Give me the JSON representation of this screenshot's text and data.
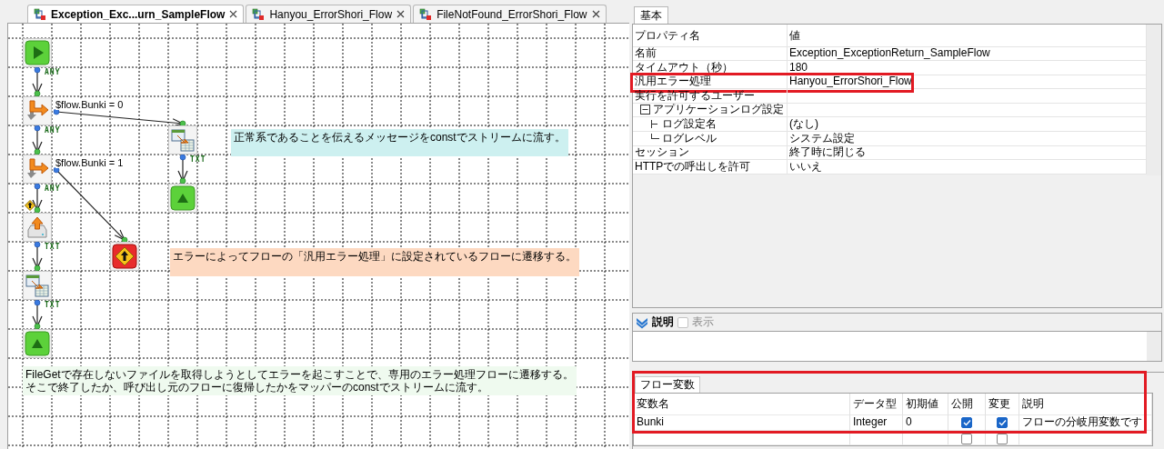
{
  "editor_tabs": [
    {
      "label": "Exception_Exc...urn_SampleFlow",
      "selected": true
    },
    {
      "label": "Hanyou_ErrorShori_Flow",
      "selected": false
    },
    {
      "label": "FileNotFound_ErrorShori_Flow",
      "selected": false
    }
  ],
  "canvas": {
    "nodes": [
      {
        "kind": "start"
      },
      {
        "kind": "branch",
        "condition": "$flow.Bunki = 0"
      },
      {
        "kind": "mapper"
      },
      {
        "kind": "branch",
        "condition": "$flow.Bunki = 1"
      },
      {
        "kind": "end"
      },
      {
        "kind": "file_put"
      },
      {
        "kind": "error"
      },
      {
        "kind": "mapper"
      },
      {
        "kind": "end"
      }
    ],
    "connectors": [
      {
        "kind": "straight",
        "label": "ANY"
      },
      {
        "kind": "straight",
        "label": "ANY"
      },
      {
        "kind": "straight",
        "label": "ANY"
      },
      {
        "kind": "straight",
        "label": "TXT"
      },
      {
        "kind": "straight",
        "label": "TXT"
      },
      {
        "kind": "straight",
        "label": "TXT"
      },
      {
        "kind": "diagonal"
      },
      {
        "kind": "diagonal"
      }
    ],
    "notes": [
      {
        "text": "正常系であることを伝えるメッセージをconstでストリームに流す。",
        "color": "#cdf0f0"
      },
      {
        "text": "エラーによってフローの「汎用エラー処理」に設定されているフローに遷移する。",
        "color": "#fdd9c1"
      },
      {
        "lines": [
          "FileGetで存在しないファイルを取得しようとしてエラーを起こすことで、専用のエラー処理フローに遷移する。",
          "そこで終了したか、呼び出し元のフローに復帰したかをマッパーのconstでストリームに流す。"
        ],
        "color": "#effaef"
      }
    ]
  },
  "properties": {
    "tab": {
      "label": "基本",
      "selected": true
    },
    "columns": [
      "プロパティ名",
      "値"
    ],
    "rows": [
      {
        "name": "名前",
        "value": "Exception_ExceptionReturn_SampleFlow"
      },
      {
        "name": "タイムアウト（秒）",
        "value": "180"
      },
      {
        "name": "汎用エラー処理",
        "value": "Hanyou_ErrorShori_Flow",
        "highlighted": true
      },
      {
        "name": "実行を許可するユーザー",
        "children": [
          {
            "name": "アプリケーションログ設定",
            "expanded": true,
            "children": [
              {
                "name": "ログ設定名",
                "value": "(なし)"
              },
              {
                "name": "ログレベル",
                "value": "システム設定"
              }
            ]
          }
        ]
      },
      {
        "name": "セッション",
        "value": "終了時に閉じる"
      },
      {
        "name": "HTTPでの呼出しを許可",
        "value": "いいえ"
      }
    ]
  },
  "description": {
    "title": "説明",
    "show": {
      "label": "表示",
      "checked": false,
      "disabled": true
    }
  },
  "variables": {
    "tab": {
      "label": "フロー変数",
      "selected": true
    },
    "highlighted": true,
    "columns": [
      "変数名",
      "データ型",
      "初期値",
      "公開",
      "変更",
      "説明"
    ],
    "rows": [
      {
        "name": "Bunki",
        "data_type": "Integer",
        "initial_value": "0",
        "public": true,
        "changeable": true,
        "description": "フローの分岐用変数です"
      },
      {
        "public": false,
        "changeable": false
      }
    ]
  }
}
